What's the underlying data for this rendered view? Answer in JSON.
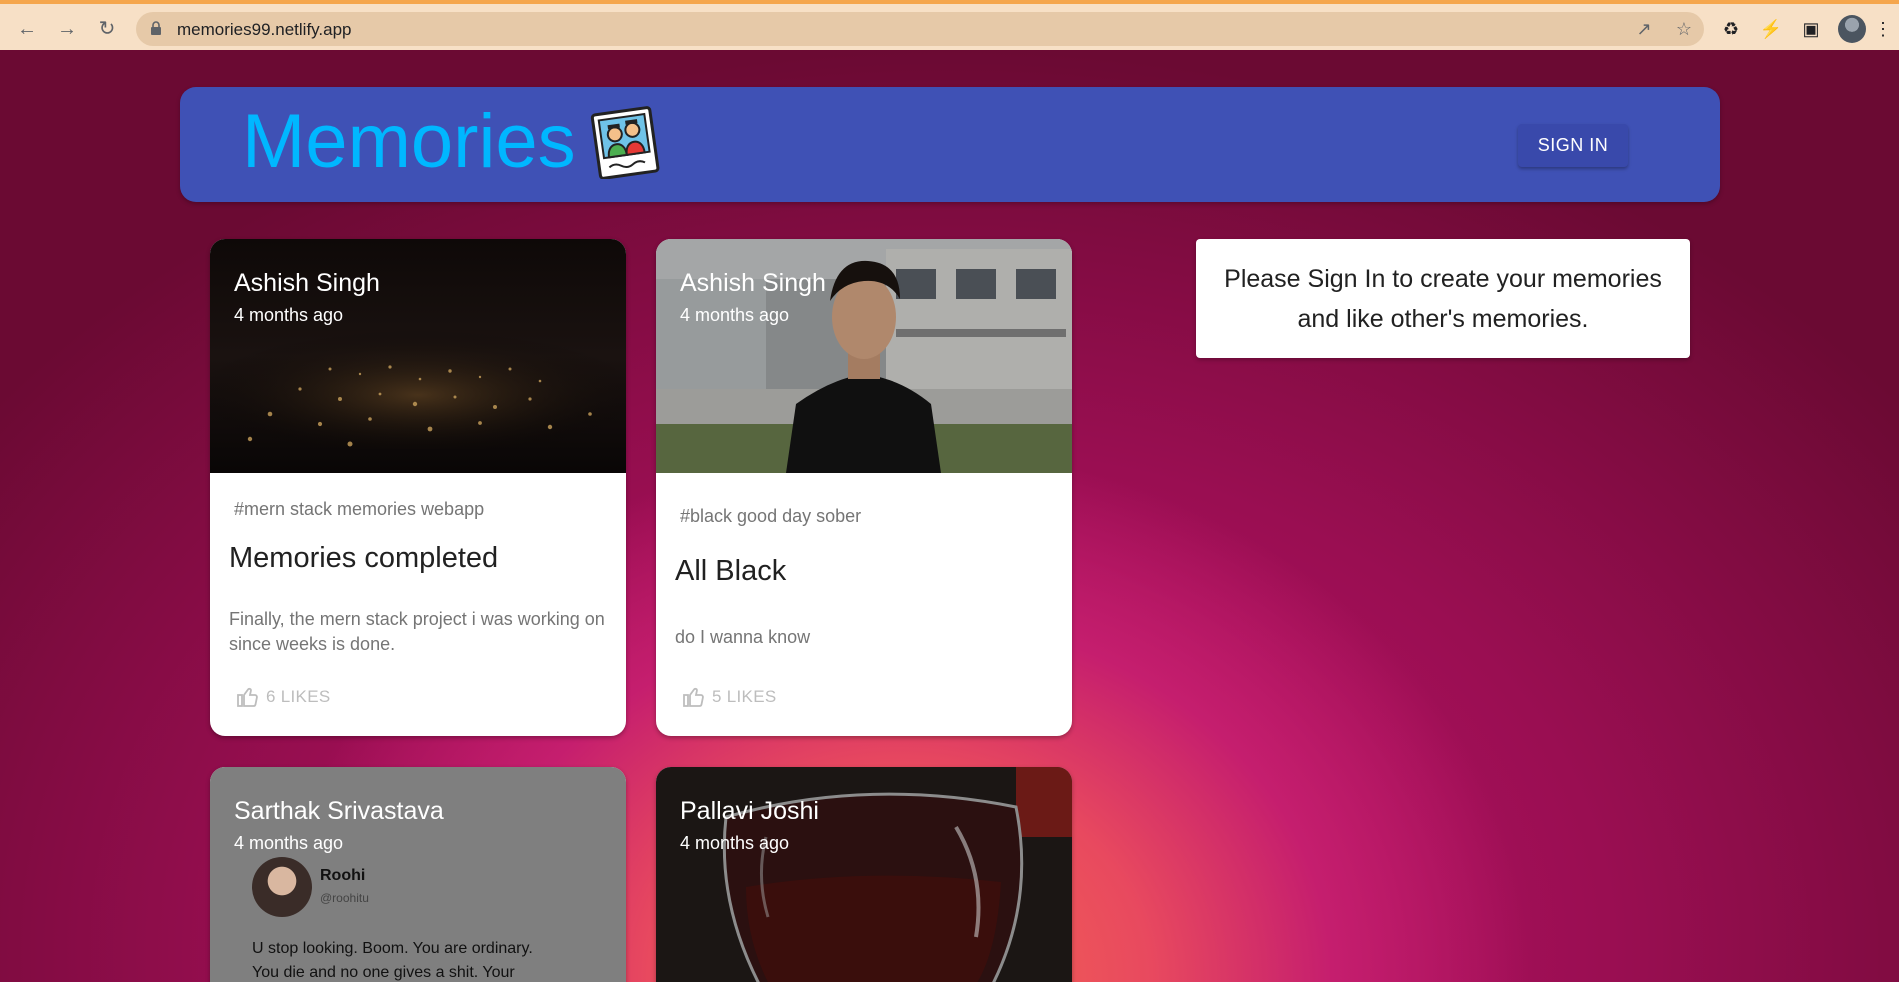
{
  "browser": {
    "url": "memories99.netlify.app"
  },
  "app": {
    "brand": "Memories",
    "sign_in_label": "SIGN IN",
    "signin_prompt": "Please Sign In to create your memories and like other's memories."
  },
  "posts": [
    {
      "author": "Ashish Singh",
      "time": "4 months ago",
      "tags": "#mern stack memories webapp",
      "title": "Memories completed",
      "message": "Finally, the mern stack project i was working on since weeks is done.",
      "likes": "6 LIKES"
    },
    {
      "author": "Ashish Singh",
      "time": "4 months ago",
      "tags": "#black good day sober",
      "title": "All Black",
      "message": "do I wanna know",
      "likes": "5 LIKES"
    },
    {
      "author": "Sarthak Srivastava",
      "time": "4 months ago",
      "tweet_name": "Roohi",
      "tweet_handle": "@roohitu",
      "tweet_text_1": "U stop looking. Boom. You are ordinary.",
      "tweet_text_2": "You die and no one gives a shit. Your"
    },
    {
      "author": "Pallavi Joshi",
      "time": "4 months ago"
    }
  ],
  "icons": {
    "back": "arrow-left-icon",
    "forward": "arrow-right-icon",
    "reload": "reload-icon",
    "lock": "lock-icon",
    "share": "share-icon",
    "star": "star-icon",
    "extensions": "puzzle-icon",
    "like": "thumb-up-icon"
  },
  "colors": {
    "appbar": "#3f51b5",
    "brand": "#00b7ff",
    "button": "#3949ab"
  }
}
